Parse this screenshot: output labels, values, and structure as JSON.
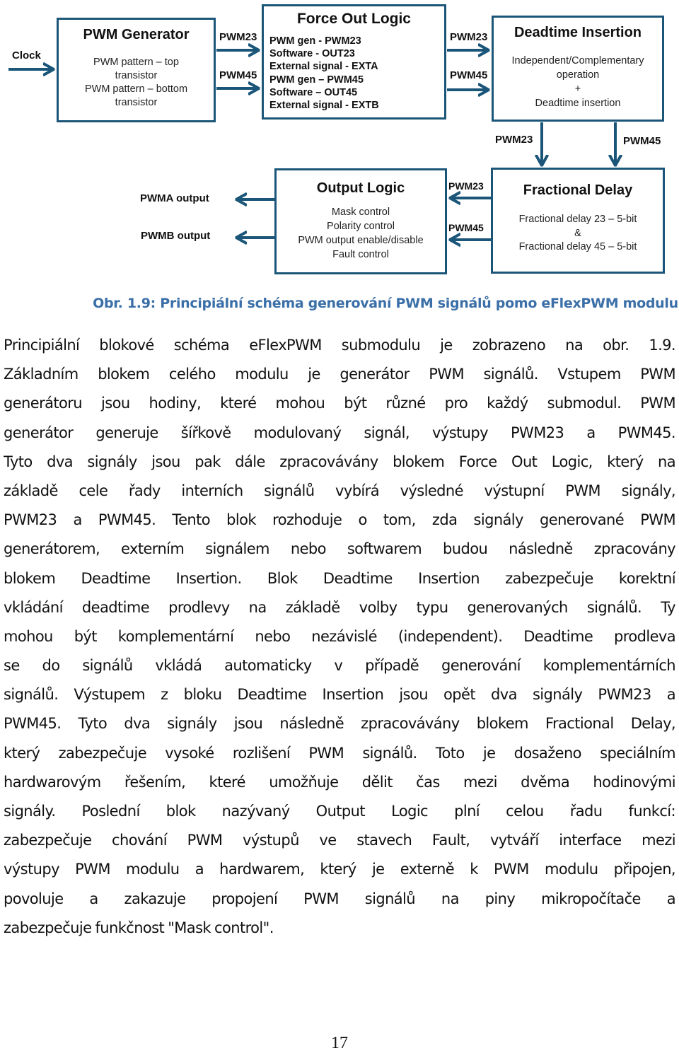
{
  "diagram": {
    "clock_label": "Clock",
    "pwm_generator": {
      "title": "PWM Generator",
      "lines": [
        "PWM pattern – top",
        "transistor",
        "PWM pattern – bottom",
        "transistor"
      ]
    },
    "force_out_logic": {
      "title": "Force Out Logic",
      "inputs": [
        "PWM gen - PWM23",
        "Software - OUT23",
        "External signal - EXTA",
        "PWM gen – PWM45",
        "Software – OUT45",
        "External signal - EXTB"
      ],
      "switch_color": "#7b2fa0"
    },
    "deadtime_insertion": {
      "title": "Deadtime Insertion",
      "lines": [
        "Independent/Complementary",
        "operation",
        "+",
        "Deadtime insertion"
      ]
    },
    "output_logic": {
      "title": "Output Logic",
      "lines": [
        "Mask control",
        "Polarity control",
        "PWM output enable/disable",
        "Fault control"
      ]
    },
    "fractional_delay": {
      "title": "Fractional Delay",
      "lines": [
        "Fractional delay 23 – 5-bit",
        "&",
        "Fractional delay 45 – 5-bit"
      ]
    },
    "signals": {
      "pwm23": "PWM23",
      "pwm45": "PWM45",
      "pwma_output": "PWMA output",
      "pwmb_output": "PWMB output"
    },
    "colors": {
      "block_border": "#1b5679",
      "arrow": "#1b5679",
      "switch": "#7b2fa0",
      "caption": "#3b6fa8"
    }
  },
  "caption": "Obr. 1.9: Principiální schéma generování PWM signálů pomo eFlexPWM modulu",
  "body_lines": [
    "Principiální blokové schéma eFlexPWM submodulu je zobrazeno na obr. 1.9.",
    "Základním blokem celého modulu je generátor PWM signálů. Vstupem PWM",
    "generátoru jsou hodiny, které mohou být různé pro každý submodul. PWM",
    "generátor generuje šířkově modulovaný signál, výstupy PWM23 a PWM45.",
    "Tyto dva signály jsou pak dále zpracovávány blokem Force Out Logic, který na",
    "základě cele řady interních signálů vybírá výsledné výstupní PWM signály,",
    "PWM23 a PWM45. Tento blok rozhoduje o tom, zda signály generované PWM",
    "generátorem, externím signálem nebo softwarem budou následně zpracovány",
    "blokem Deadtime Insertion. Blok Deadtime Insertion zabezpečuje korektní",
    "vkládání deadtime prodlevy na základě volby typu generovaných signálů. Ty",
    "mohou být komplementární nebo nezávislé (independent). Deadtime prodleva",
    "se do signálů vkládá automaticky v případě generování komplementárních",
    "signálů. Výstupem z bloku Deadtime Insertion jsou opět dva signály PWM23 a",
    "PWM45. Tyto dva signály jsou následně zpracovávány blokem Fractional Delay,",
    "který zabezpečuje vysoké rozlišení PWM signálů. Toto je dosaženo speciálním",
    "hardwarovým řešením, které umožňuje dělit čas mezi dvěma hodinovými",
    "signály. Poslední blok nazývaný Output Logic plní celou řadu funkcí:",
    "zabezpečuje chování PWM výstupů ve stavech Fault, vytváří interface mezi",
    "výstupy PWM modulu a hardwarem, který je externě k PWM modulu připojen,",
    "povoluje a zakazuje propojení PWM signálů na piny mikropočítače a",
    "zabezpečuje funkčnost \"Mask control\"."
  ],
  "page_number": "17"
}
